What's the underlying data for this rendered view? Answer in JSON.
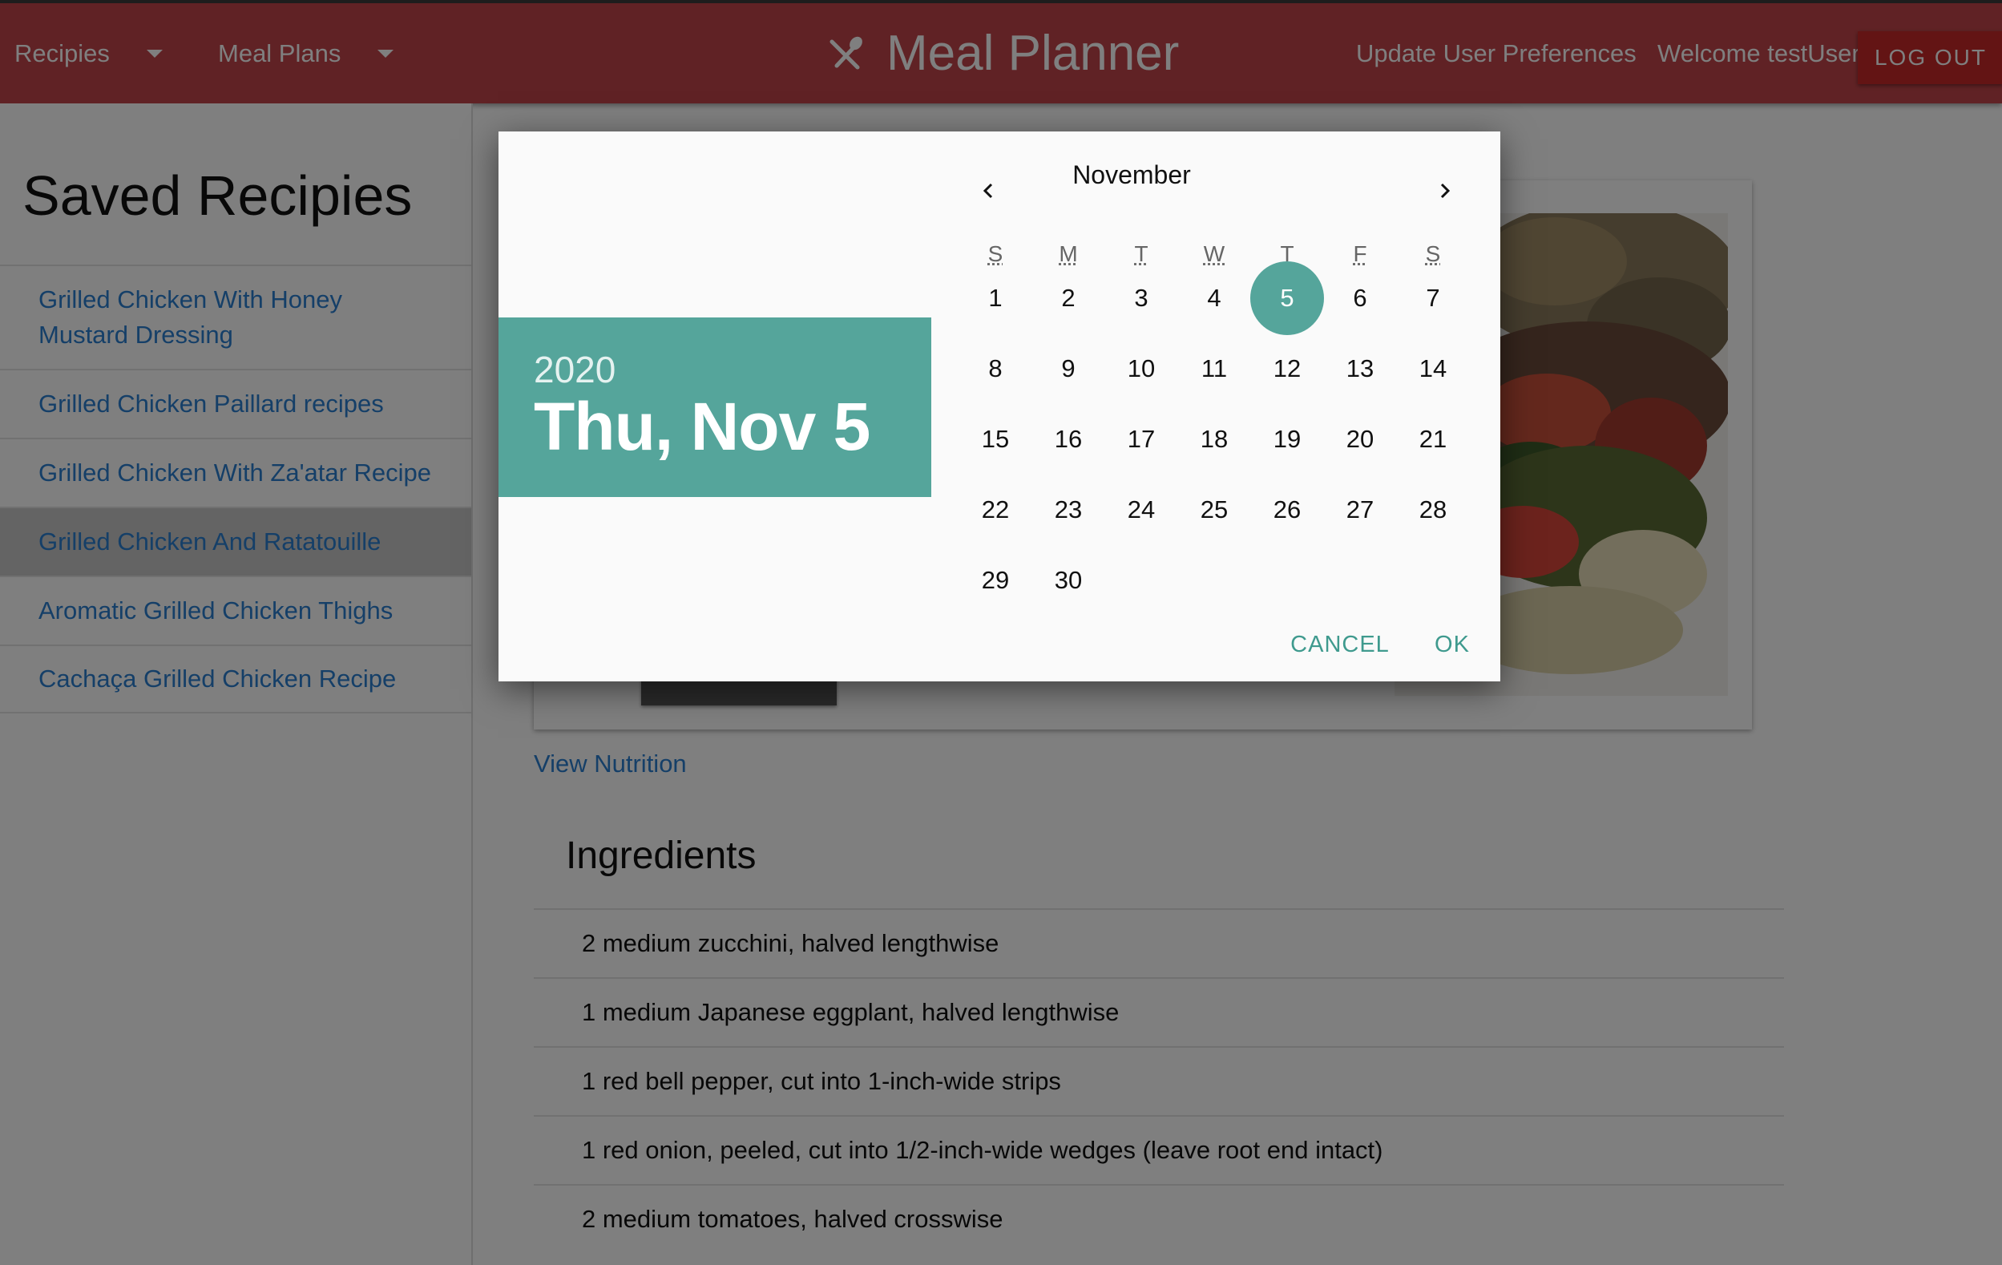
{
  "header": {
    "nav_recipes": "Recipies",
    "nav_meal_plans": "Meal Plans",
    "brand_title": "Meal Planner",
    "update_prefs": "Update User Preferences",
    "welcome": "Welcome testUser",
    "logout": "LOG OUT",
    "bar_color": "#c0454a"
  },
  "sidebar": {
    "title": "Saved Recipies",
    "items": [
      {
        "label": "Grilled Chicken With Honey Mustard Dressing"
      },
      {
        "label": "Grilled Chicken Paillard recipes"
      },
      {
        "label": "Grilled Chicken With Za'atar Recipe"
      },
      {
        "label": "Grilled Chicken And Ratatouille"
      },
      {
        "label": "Aromatic Grilled Chicken Thighs"
      },
      {
        "label": "Cachaça Grilled Chicken Recipe"
      }
    ],
    "active_index": 3
  },
  "main": {
    "view_nutrition": "View Nutrition",
    "ingredients_title": "Ingredients",
    "ingredients": [
      "2 medium zucchini, halved lengthwise",
      "1 medium Japanese eggplant, halved lengthwise",
      "1 red bell pepper, cut into 1-inch-wide strips",
      "1 red onion, peeled, cut into 1/2-inch-wide wedges (leave root end intact)",
      "2 medium tomatoes, halved crosswise"
    ]
  },
  "date_picker": {
    "year": "2020",
    "selected_date": "Thu, Nov 5",
    "month_label": "November",
    "weekdays": [
      "S",
      "M",
      "T",
      "W",
      "T",
      "F",
      "S"
    ],
    "days": [
      "1",
      "2",
      "3",
      "4",
      "5",
      "6",
      "7",
      "8",
      "9",
      "10",
      "11",
      "12",
      "13",
      "14",
      "15",
      "16",
      "17",
      "18",
      "19",
      "20",
      "21",
      "22",
      "23",
      "24",
      "25",
      "26",
      "27",
      "28",
      "29",
      "30"
    ],
    "selected_day": "5",
    "cancel": "CANCEL",
    "ok": "OK",
    "accent_color": "#55a59b"
  }
}
